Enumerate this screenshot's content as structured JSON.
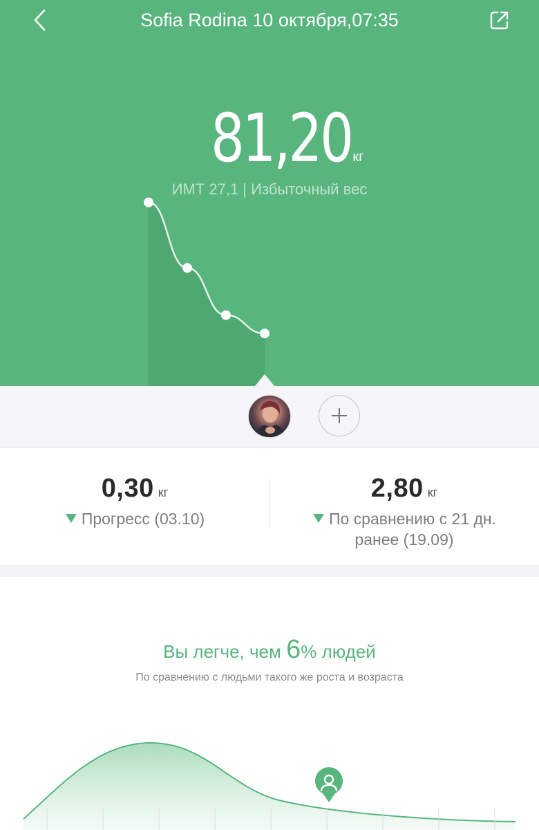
{
  "header": {
    "title": "Sofia Rodina 10 октября,07:35",
    "back_icon": "chevron-left-icon",
    "share_icon": "share-icon"
  },
  "weight": {
    "value": "81,20",
    "unit": "кг",
    "bmi_text": "ИМТ 27,1 | Избыточный вес"
  },
  "trend_chart": {
    "type": "line",
    "points": [
      81.7,
      81.45,
      81.27,
      81.2
    ],
    "ylim": [
      81.0,
      82.05
    ],
    "selected_index": 3
  },
  "profiles": {
    "avatar_name": "avatar",
    "add_icon": "plus-icon"
  },
  "stats": {
    "progress": {
      "value": "0,30",
      "unit": "кг",
      "label": "Прогресс (03.10)",
      "direction": "down"
    },
    "compare": {
      "value": "2,80",
      "unit": "кг",
      "label": "По сравнению с 21 дн. ранее (19.09)",
      "direction": "down"
    }
  },
  "distribution": {
    "heading_prefix": "Вы легче, чем ",
    "percent_value": "6",
    "heading_suffix": "% людей",
    "subtitle": "По сравнению с людьми такого же роста и возраста",
    "user_marker_icon": "user-pin-icon"
  },
  "colors": {
    "accent": "#58b57d",
    "accent_dark": "#4aa56e",
    "text_dark": "#2a2a2a",
    "text_muted": "#7d7d7d"
  }
}
